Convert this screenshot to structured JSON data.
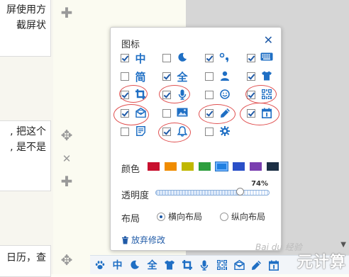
{
  "page": {
    "card1_lines": [
      "屏使用方",
      "截屏状"
    ],
    "card2_lines": [
      ", 把这个",
      ", 是不是"
    ],
    "card3_lines": [
      "日历，查"
    ]
  },
  "side_controls": {
    "add1": "✚",
    "move1": "✥",
    "close1": "✕",
    "add2": "✚",
    "move2": "✥"
  },
  "panel": {
    "title": "图标",
    "close_label": "✕",
    "icons": [
      {
        "name": "chinese-char-icon",
        "glyph": "中",
        "checked": true
      },
      {
        "name": "moon-icon",
        "glyph": "☾",
        "checked": false
      },
      {
        "name": "punctuation-icon",
        "glyph": "°,",
        "checked": true
      },
      {
        "name": "keyboard-icon",
        "glyph": "⌨",
        "checked": true
      },
      {
        "name": "simplified-char-icon",
        "glyph": "简",
        "checked": false
      },
      {
        "name": "fullwidth-char-icon",
        "glyph": "全",
        "checked": true
      },
      {
        "name": "user-icon",
        "glyph": "",
        "checked": false
      },
      {
        "name": "shirt-icon",
        "glyph": "",
        "checked": true
      },
      {
        "name": "crop-icon",
        "glyph": "",
        "checked": true
      },
      {
        "name": "microphone-icon",
        "glyph": "",
        "checked": true
      },
      {
        "name": "smiley-icon",
        "glyph": "☺",
        "checked": false
      },
      {
        "name": "qrcode-icon",
        "glyph": "",
        "checked": true
      },
      {
        "name": "mail-icon",
        "glyph": "",
        "checked": true
      },
      {
        "name": "image-icon",
        "glyph": "",
        "checked": false
      },
      {
        "name": "pen-icon",
        "glyph": "",
        "checked": true
      },
      {
        "name": "calendar-icon",
        "glyph": "1",
        "checked": true
      },
      {
        "name": "note-icon",
        "glyph": "",
        "checked": false
      },
      {
        "name": "bell-icon",
        "glyph": "",
        "checked": true
      },
      {
        "name": "gear-icon",
        "glyph": "",
        "checked": false
      }
    ],
    "color_label": "颜色",
    "colors": [
      "#c8102e",
      "#f08c00",
      "#c0b800",
      "#2e9e3e",
      "#1f7fe0",
      "#2a4fc8",
      "#7a3fb0",
      "#1c2f45"
    ],
    "selected_color_index": 4,
    "opacity_label": "透明度",
    "opacity_value": "74%",
    "opacity_fraction": 0.74,
    "layout_label": "布局",
    "layout_options": [
      "横向布局",
      "纵向布局"
    ],
    "layout_selected": 0,
    "discard_label": "放弃修改"
  },
  "toolbar": {
    "items": [
      "paw-icon",
      "chinese-char-icon",
      "moon-icon",
      "fullwidth-char-icon",
      "shirt-icon",
      "crop-icon",
      "microphone-icon",
      "qrcode-icon",
      "mail-icon",
      "pen-icon",
      "calendar-icon"
    ],
    "labels": {
      "zh": "中",
      "full": "全"
    }
  },
  "watermark": {
    "text": "元计算",
    "small": "Bai du 经验"
  },
  "colors": {
    "accent": "#1f6fc4",
    "highlight_circle": "#e05050"
  }
}
